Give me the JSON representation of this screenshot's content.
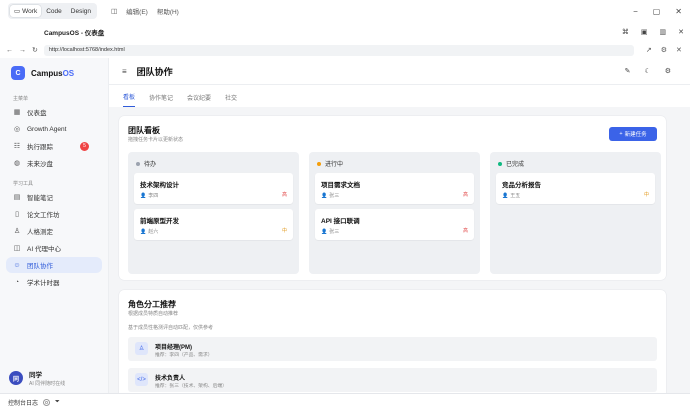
{
  "appbar": {
    "modes": [
      "Work",
      "Code",
      "Design"
    ],
    "menus": [
      "编辑(E)",
      "帮助(H)"
    ]
  },
  "window": {
    "title": "CampusOS - 仪表盘"
  },
  "browser": {
    "url": "http://localhost:5768/index.html"
  },
  "sidebar": {
    "brand_prefix": "Campus",
    "brand_suffix": "OS",
    "logo_letter": "C",
    "section_main": "主菜单",
    "section_tools": "学习工具",
    "main_items": [
      {
        "label": "仪表盘",
        "icon": "grid-icon"
      },
      {
        "label": "Growth Agent",
        "icon": "target-icon"
      },
      {
        "label": "执行跟踪",
        "icon": "list-icon",
        "badge": "5"
      },
      {
        "label": "未来沙盘",
        "icon": "globe-icon"
      }
    ],
    "tool_items": [
      {
        "label": "智能笔记",
        "icon": "note-icon"
      },
      {
        "label": "论文工作坊",
        "icon": "paper-icon"
      },
      {
        "label": "人格测定",
        "icon": "person-icon"
      },
      {
        "label": "AI 代理中心",
        "icon": "robot-icon"
      },
      {
        "label": "团队协作",
        "icon": "team-icon",
        "active": true
      },
      {
        "label": "学术计时器",
        "icon": "timer-icon"
      }
    ],
    "user": {
      "initial": "同",
      "name": "同学",
      "status": "AI 同伴随时在线"
    }
  },
  "main": {
    "title": "团队协作",
    "tabs": [
      "看板",
      "协作笔记",
      "会议纪要",
      "社交"
    ],
    "active_tab": 0
  },
  "board": {
    "title": "团队看板",
    "subtitle": "拖拽任务卡片以更新状态",
    "new_button": "新建任务",
    "columns": [
      {
        "name": "待办",
        "color": "#9ca3af",
        "tasks": [
          {
            "title": "技术架构设计",
            "assignee": "李四",
            "priority": "高",
            "level": "high"
          },
          {
            "title": "前端原型开发",
            "assignee": "赵六",
            "priority": "中",
            "level": "mid"
          }
        ]
      },
      {
        "name": "进行中",
        "color": "#f59e0b",
        "tasks": [
          {
            "title": "项目需求文档",
            "assignee": "张三",
            "priority": "高",
            "level": "high"
          },
          {
            "title": "API 接口联调",
            "assignee": "张三",
            "priority": "高",
            "level": "high"
          }
        ]
      },
      {
        "name": "已完成",
        "color": "#10b981",
        "tasks": [
          {
            "title": "竞品分析报告",
            "assignee": "王五",
            "priority": "中",
            "level": "mid"
          }
        ]
      }
    ]
  },
  "roles": {
    "title": "角色分工推荐",
    "subtitle": "根据成员特质自动推荐",
    "note": "基于成员性格测评自动匹配，仅供参考",
    "items": [
      {
        "name": "项目经理(PM)",
        "desc": "推荐：李四（产品、需求）",
        "icon": "user-icon"
      },
      {
        "name": "技术负责人",
        "desc": "推荐：张三（技术、架构、后端）",
        "icon": "code-icon"
      }
    ]
  },
  "footer": {
    "label": "控制台日志",
    "count": "0"
  }
}
